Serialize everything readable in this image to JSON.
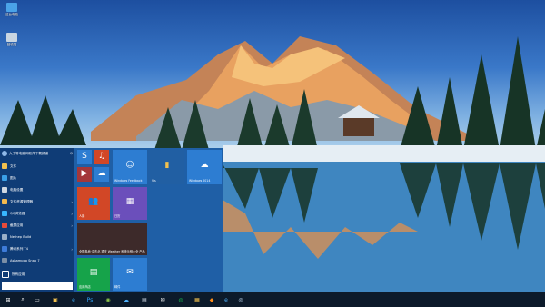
{
  "desktop": {
    "icons": [
      {
        "label": "这台电脑",
        "icon": "computer-icon"
      },
      {
        "label": "回收站",
        "icon": "recycle-bin-icon"
      }
    ]
  },
  "start_menu": {
    "user": {
      "name": "大于等电脑网软件下载频道"
    },
    "items": [
      {
        "label": "文件",
        "icon": "folder-icon"
      },
      {
        "label": "图片",
        "icon": "pictures-icon"
      },
      {
        "label": "电脑设置",
        "icon": "gear-icon"
      },
      {
        "label": "文件资源管理器",
        "icon": "explorer-icon",
        "has_submenu": true
      },
      {
        "label": "QQ浏览器",
        "icon": "browser-icon",
        "has_submenu": true
      },
      {
        "label": "截屏应用",
        "icon": "snip-icon",
        "has_submenu": true
      },
      {
        "label": "Nethep Build",
        "icon": "app-icon"
      },
      {
        "label": "腾讯系列 T4",
        "icon": "tencent-icon",
        "has_submenu": true
      },
      {
        "label": "Ashampoo Snap 7",
        "icon": "snap-icon"
      },
      {
        "label": "所有应用",
        "icon": "apps-icon"
      }
    ],
    "search_placeholder": "",
    "tiles": [
      {
        "label": "",
        "icon": "skype-icon"
      },
      {
        "label": "",
        "icon": "music-icon"
      },
      {
        "label": "Windows Feedback",
        "icon": "feedback-icon"
      },
      {
        "label": "",
        "icon": "folder-tile-icon"
      },
      {
        "label": "Vis",
        "icon": ""
      },
      {
        "label": "Windows 2014",
        "icon": "cloud-icon"
      },
      {
        "label": "",
        "icon": "video-icon"
      },
      {
        "label": "",
        "icon": "onedrive-icon"
      },
      {
        "label": "人脉",
        "icon": "people-icon"
      },
      {
        "label": "日历",
        "icon": "calendar-icon"
      },
      {
        "label": "全国各地·中东北 重庆 Weather 系统示例大全 产品",
        "icon": ""
      },
      {
        "label": "应用商店",
        "icon": "store-icon"
      },
      {
        "label": "邮件",
        "icon": "mail-icon"
      }
    ]
  },
  "taskbar": {
    "items": [
      {
        "icon": "windows-start-icon",
        "label": "⊞"
      },
      {
        "icon": "search-icon",
        "label": "⌕"
      },
      {
        "icon": "task-view-icon",
        "label": "▭"
      },
      {
        "icon": "explorer-icon",
        "label": "▣"
      },
      {
        "icon": "edge-icon",
        "label": "e"
      },
      {
        "icon": "photoshop-icon",
        "label": "Ps"
      },
      {
        "icon": "chat-icon",
        "label": "◉"
      },
      {
        "icon": "cloud-icon",
        "label": "☁"
      },
      {
        "icon": "store-icon",
        "label": "▤"
      },
      {
        "icon": "mail-icon",
        "label": "✉"
      },
      {
        "icon": "green-icon",
        "label": "◍"
      },
      {
        "icon": "office-icon",
        "label": "▦"
      },
      {
        "icon": "orange-icon",
        "label": "◆"
      },
      {
        "icon": "ie-icon",
        "label": "e"
      },
      {
        "icon": "globe-icon",
        "label": "◎"
      }
    ]
  },
  "colors": {
    "start_bg": "#1f5fa6",
    "left_bg": "#0f3c76",
    "taskbar_bg": "#0c1a2a",
    "tile_red": "#d24726",
    "tile_blue": "#2d7dd2",
    "tile_green": "#16a34a",
    "tile_purple": "#6b4fbb"
  }
}
